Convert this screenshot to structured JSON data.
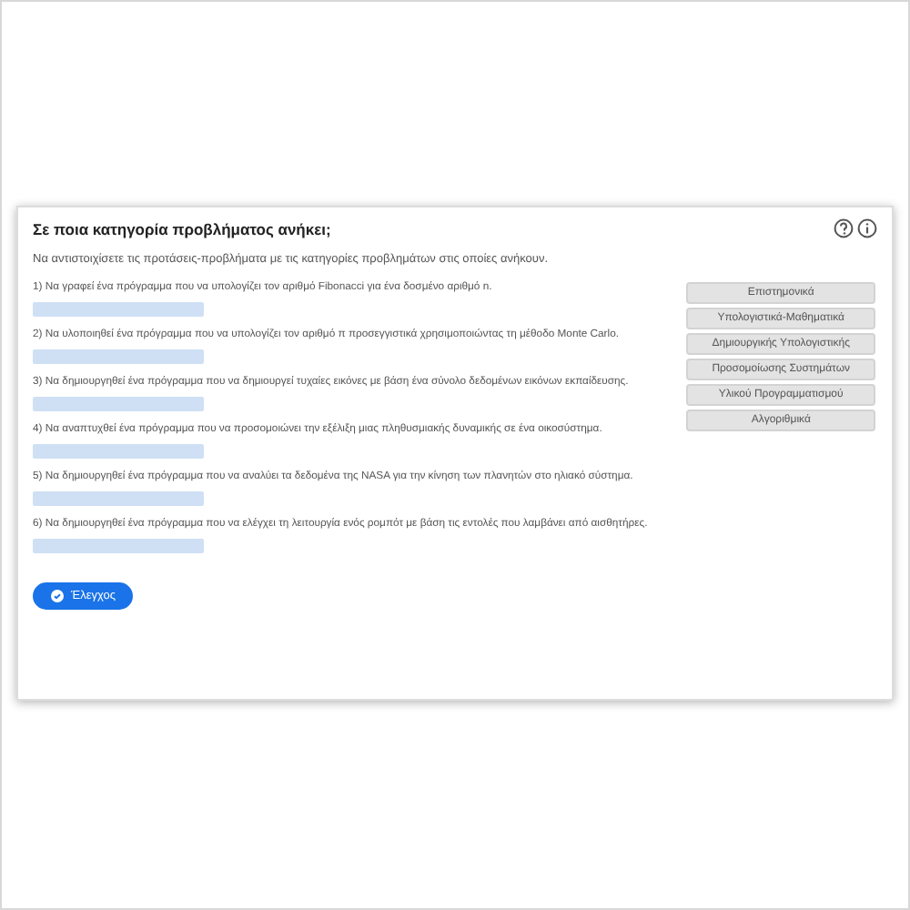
{
  "title": "Σε ποια κατηγορία προβλήματος ανήκει;",
  "instructions": "Να αντιστοιχίσετε τις προτάσεις-προβλήματα με τις κατηγορίες προβλημάτων στις οποίες ανήκουν.",
  "problems": [
    {
      "text": "1) Να γραφεί ένα πρόγραμμα που να υπολογίζει τον αριθμό Fibonacci για ένα δοσμένο αριθμό n."
    },
    {
      "text": "2) Να υλοποιηθεί ένα πρόγραμμα που να υπολογίζει τον αριθμό π προσεγγιστικά χρησιμοποιώντας τη μέθοδο Monte Carlo."
    },
    {
      "text": "3) Να δημιουργηθεί ένα πρόγραμμα που να δημιουργεί τυχαίες εικόνες με βάση ένα σύνολο δεδομένων εικόνων εκπαίδευσης."
    },
    {
      "text": "4) Να αναπτυχθεί ένα πρόγραμμα που να προσομοιώνει την εξέλιξη μιας πληθυσμιακής δυναμικής σε ένα οικοσύστημα."
    },
    {
      "text": "5) Να δημιουργηθεί ένα πρόγραμμα που να αναλύει τα δεδομένα της NASA για την κίνηση των πλανητών στο ηλιακό σύστημα."
    },
    {
      "text": "6) Να δημιουργηθεί ένα πρόγραμμα που να ελέγχει τη λειτουργία ενός ρομπότ με βάση τις εντολές που λαμβάνει από αισθητήρες."
    }
  ],
  "categories": [
    "Επιστημονικά",
    "Υπολογιστικά-Μαθηματικά",
    "Δημιουργικής Υπολογιστικής",
    "Προσομοίωσης Συστημάτων",
    "Υλικού Προγραμματισμού",
    "Αλγοριθμικά"
  ],
  "check_button": "Έλεγχος"
}
